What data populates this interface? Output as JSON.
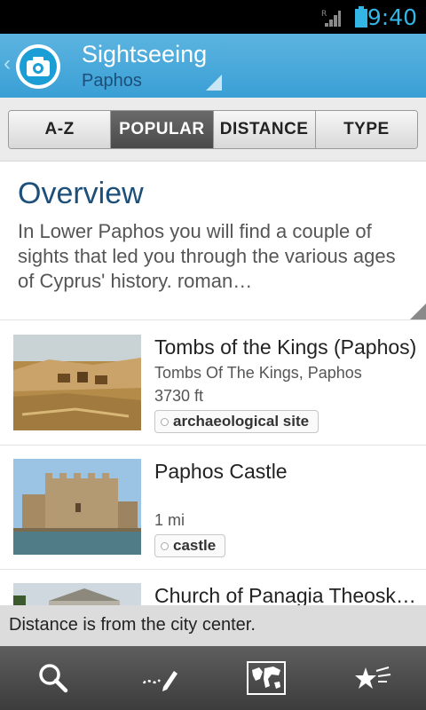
{
  "status_bar": {
    "time": "9:40",
    "network_indicator": "R"
  },
  "action_bar": {
    "title": "Sightseeing",
    "subtitle": "Paphos"
  },
  "tabs": [
    {
      "label": "A-Z",
      "active": false
    },
    {
      "label": "POPULAR",
      "active": true
    },
    {
      "label": "DISTANCE",
      "active": false
    },
    {
      "label": "TYPE",
      "active": false
    }
  ],
  "overview": {
    "heading": "Overview",
    "text": "In Lower Paphos you will find a couple of sights that led you through the various ages of Cyprus' history. roman…"
  },
  "places": [
    {
      "name": "Tombs of the Kings (Paphos)",
      "address": "Tombs Of The Kings, Paphos",
      "distance": "3730 ft",
      "tag": "archaeological site"
    },
    {
      "name": "Paphos Castle",
      "address": "",
      "distance": "1 mi",
      "tag": "castle"
    },
    {
      "name": "Church of Panagia Theoskepasti",
      "address": "",
      "distance": "",
      "tag": ""
    }
  ],
  "toast": "Distance is from the city center.",
  "bottom_bar": {
    "icons": [
      "search-icon",
      "route-pen-icon",
      "world-map-icon",
      "favorites-stars-icon"
    ]
  },
  "colors": {
    "accent": "#33b5e5",
    "action_bar": "#4aa9dc",
    "title_dark": "#1c4f7a"
  }
}
